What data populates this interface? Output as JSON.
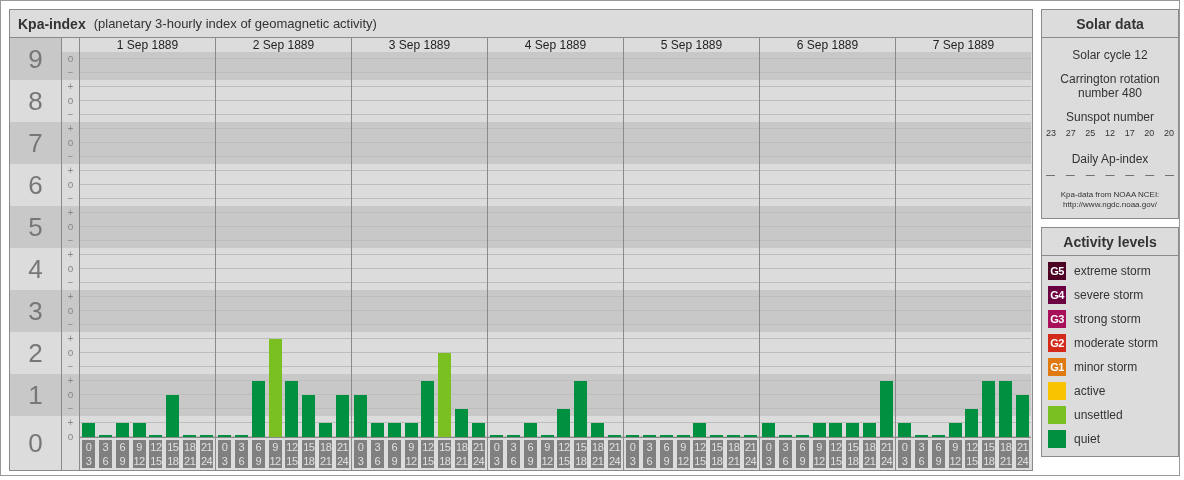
{
  "chart": {
    "title": "Kpa-index",
    "subtitle": "(planetary 3-hourly index of geomagnetic activity)",
    "scale": [
      {
        "label": "9",
        "sublabels": [
          "o",
          "−"
        ]
      },
      {
        "label": "8",
        "sublabels": [
          "+",
          "o",
          "−"
        ]
      },
      {
        "label": "7",
        "sublabels": [
          "+",
          "o",
          "−"
        ]
      },
      {
        "label": "6",
        "sublabels": [
          "+",
          "o",
          "−"
        ]
      },
      {
        "label": "5",
        "sublabels": [
          "+",
          "o",
          "−"
        ]
      },
      {
        "label": "4",
        "sublabels": [
          "+",
          "o",
          "−"
        ]
      },
      {
        "label": "3",
        "sublabels": [
          "+",
          "o",
          "−"
        ]
      },
      {
        "label": "2",
        "sublabels": [
          "+",
          "o",
          "−"
        ]
      },
      {
        "label": "1",
        "sublabels": [
          "+",
          "o",
          "−"
        ]
      },
      {
        "label": "0",
        "sublabels": [
          "+",
          "o"
        ]
      }
    ],
    "days": [
      {
        "date": "1 Sep 1889",
        "bars": [
          {
            "hours": [
              "0",
              "3"
            ],
            "level": 0.037,
            "color": "#009040"
          },
          {
            "hours": [
              "3",
              "6"
            ],
            "level": 0,
            "color": "#009040"
          },
          {
            "hours": [
              "6",
              "9"
            ],
            "level": 0.037,
            "color": "#009040"
          },
          {
            "hours": [
              "9",
              "12"
            ],
            "level": 0.037,
            "color": "#009040"
          },
          {
            "hours": [
              "12",
              "15"
            ],
            "level": 0,
            "color": "#009040"
          },
          {
            "hours": [
              "15",
              "18"
            ],
            "level": 0.111,
            "color": "#009040"
          },
          {
            "hours": [
              "18",
              "21"
            ],
            "level": 0,
            "color": "#009040"
          },
          {
            "hours": [
              "21",
              "24"
            ],
            "level": 0,
            "color": "#009040"
          }
        ]
      },
      {
        "date": "2 Sep 1889",
        "bars": [
          {
            "hours": [
              "0",
              "3"
            ],
            "level": 0,
            "color": "#009040"
          },
          {
            "hours": [
              "3",
              "6"
            ],
            "level": 0,
            "color": "#009040"
          },
          {
            "hours": [
              "6",
              "9"
            ],
            "level": 0.148,
            "color": "#009040"
          },
          {
            "hours": [
              "9",
              "12"
            ],
            "level": 0.259,
            "color": "#7ac021"
          },
          {
            "hours": [
              "12",
              "15"
            ],
            "level": 0.148,
            "color": "#009040"
          },
          {
            "hours": [
              "15",
              "18"
            ],
            "level": 0.111,
            "color": "#009040"
          },
          {
            "hours": [
              "18",
              "21"
            ],
            "level": 0.037,
            "color": "#009040"
          },
          {
            "hours": [
              "21",
              "24"
            ],
            "level": 0.111,
            "color": "#009040"
          }
        ]
      },
      {
        "date": "3 Sep 1889",
        "bars": [
          {
            "hours": [
              "0",
              "3"
            ],
            "level": 0.111,
            "color": "#009040"
          },
          {
            "hours": [
              "3",
              "6"
            ],
            "level": 0.037,
            "color": "#009040"
          },
          {
            "hours": [
              "6",
              "9"
            ],
            "level": 0.037,
            "color": "#009040"
          },
          {
            "hours": [
              "9",
              "12"
            ],
            "level": 0.037,
            "color": "#009040"
          },
          {
            "hours": [
              "12",
              "15"
            ],
            "level": 0.148,
            "color": "#009040"
          },
          {
            "hours": [
              "15",
              "18"
            ],
            "level": 0.222,
            "color": "#7ac021"
          },
          {
            "hours": [
              "18",
              "21"
            ],
            "level": 0.074,
            "color": "#009040"
          },
          {
            "hours": [
              "21",
              "24"
            ],
            "level": 0.037,
            "color": "#009040"
          }
        ]
      },
      {
        "date": "4 Sep 1889",
        "bars": [
          {
            "hours": [
              "0",
              "3"
            ],
            "level": 0,
            "color": "#009040"
          },
          {
            "hours": [
              "3",
              "6"
            ],
            "level": 0,
            "color": "#009040"
          },
          {
            "hours": [
              "6",
              "9"
            ],
            "level": 0.037,
            "color": "#009040"
          },
          {
            "hours": [
              "9",
              "12"
            ],
            "level": 0,
            "color": "#009040"
          },
          {
            "hours": [
              "12",
              "15"
            ],
            "level": 0.074,
            "color": "#009040"
          },
          {
            "hours": [
              "15",
              "18"
            ],
            "level": 0.148,
            "color": "#009040"
          },
          {
            "hours": [
              "18",
              "21"
            ],
            "level": 0.037,
            "color": "#009040"
          },
          {
            "hours": [
              "21",
              "24"
            ],
            "level": 0,
            "color": "#009040"
          }
        ]
      },
      {
        "date": "5 Sep 1889",
        "bars": [
          {
            "hours": [
              "0",
              "3"
            ],
            "level": 0,
            "color": "#009040"
          },
          {
            "hours": [
              "3",
              "6"
            ],
            "level": 0,
            "color": "#009040"
          },
          {
            "hours": [
              "6",
              "9"
            ],
            "level": 0,
            "color": "#009040"
          },
          {
            "hours": [
              "9",
              "12"
            ],
            "level": 0,
            "color": "#009040"
          },
          {
            "hours": [
              "12",
              "15"
            ],
            "level": 0.037,
            "color": "#009040"
          },
          {
            "hours": [
              "15",
              "18"
            ],
            "level": 0,
            "color": "#009040"
          },
          {
            "hours": [
              "18",
              "21"
            ],
            "level": 0,
            "color": "#009040"
          },
          {
            "hours": [
              "21",
              "24"
            ],
            "level": 0,
            "color": "#009040"
          }
        ]
      },
      {
        "date": "6 Sep 1889",
        "bars": [
          {
            "hours": [
              "0",
              "3"
            ],
            "level": 0.037,
            "color": "#009040"
          },
          {
            "hours": [
              "3",
              "6"
            ],
            "level": 0,
            "color": "#009040"
          },
          {
            "hours": [
              "6",
              "9"
            ],
            "level": 0,
            "color": "#009040"
          },
          {
            "hours": [
              "9",
              "12"
            ],
            "level": 0.037,
            "color": "#009040"
          },
          {
            "hours": [
              "12",
              "15"
            ],
            "level": 0.037,
            "color": "#009040"
          },
          {
            "hours": [
              "15",
              "18"
            ],
            "level": 0.037,
            "color": "#009040"
          },
          {
            "hours": [
              "18",
              "21"
            ],
            "level": 0.037,
            "color": "#009040"
          },
          {
            "hours": [
              "21",
              "24"
            ],
            "level": 0.148,
            "color": "#009040"
          }
        ]
      },
      {
        "date": "7 Sep 1889",
        "bars": [
          {
            "hours": [
              "0",
              "3"
            ],
            "level": 0.037,
            "color": "#009040"
          },
          {
            "hours": [
              "3",
              "6"
            ],
            "level": 0,
            "color": "#009040"
          },
          {
            "hours": [
              "6",
              "9"
            ],
            "level": 0,
            "color": "#009040"
          },
          {
            "hours": [
              "9",
              "12"
            ],
            "level": 0.037,
            "color": "#009040"
          },
          {
            "hours": [
              "12",
              "15"
            ],
            "level": 0.074,
            "color": "#009040"
          },
          {
            "hours": [
              "15",
              "18"
            ],
            "level": 0.148,
            "color": "#009040"
          },
          {
            "hours": [
              "18",
              "21"
            ],
            "level": 0.148,
            "color": "#009040"
          },
          {
            "hours": [
              "21",
              "24"
            ],
            "level": 0.111,
            "color": "#009040"
          }
        ]
      }
    ]
  },
  "solar_data": {
    "title": "Solar data",
    "solar_cycle": "Solar cycle 12",
    "carrington_rotation": "Carrington rotation number 480",
    "sunspot_title": "Sunspot number",
    "sunspot_values": [
      "23",
      "27",
      "25",
      "12",
      "17",
      "20",
      "20"
    ],
    "ap_title": "Daily Ap-index",
    "ap_values": [
      "—",
      "—",
      "—",
      "—",
      "—",
      "—",
      "—"
    ],
    "source_note": "Kpa-data from NOAA NCEI:",
    "source_url": "http://www.ngdc.noaa.gov/"
  },
  "activity_levels": {
    "title": "Activity levels",
    "items": [
      {
        "badge": "G5",
        "label": "extreme storm",
        "color": "#4b0024"
      },
      {
        "badge": "G4",
        "label": "severe storm",
        "color": "#6b0040"
      },
      {
        "badge": "G3",
        "label": "strong storm",
        "color": "#a8105a"
      },
      {
        "badge": "G2",
        "label": "moderate storm",
        "color": "#d42a1a"
      },
      {
        "badge": "G1",
        "label": "minor storm",
        "color": "#e07a10"
      },
      {
        "label": "active",
        "color": "#f8c400"
      },
      {
        "label": "unsettled",
        "color": "#7ac021"
      },
      {
        "label": "quiet",
        "color": "#009040"
      }
    ]
  }
}
